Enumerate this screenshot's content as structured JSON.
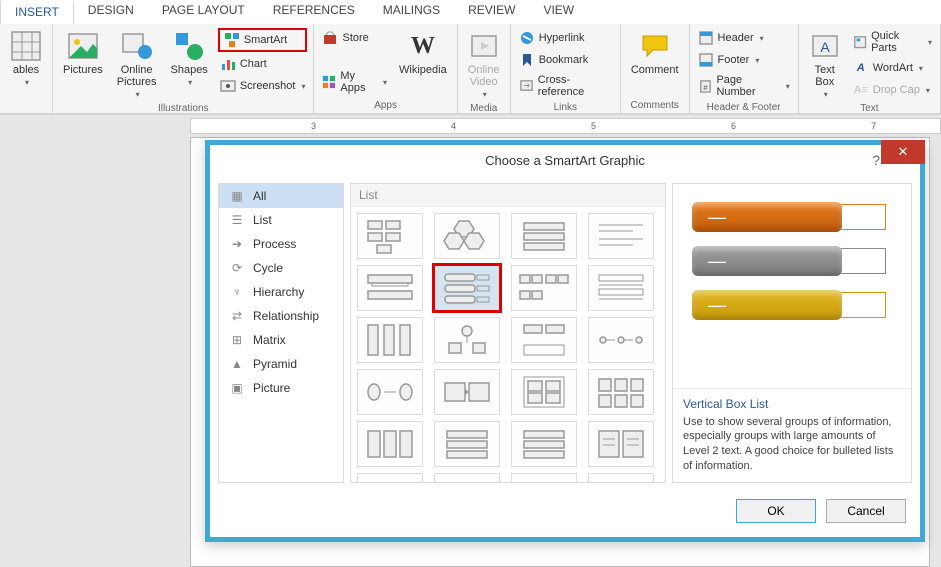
{
  "ribbon": {
    "tabs": [
      "INSERT",
      "DESIGN",
      "PAGE LAYOUT",
      "REFERENCES",
      "MAILINGS",
      "REVIEW",
      "VIEW"
    ],
    "active_tab": "INSERT",
    "groups": {
      "tables": {
        "label": "",
        "table_btn": "ables"
      },
      "illustrations": {
        "label": "Illustrations",
        "pictures": "Pictures",
        "online_pictures": "Online\nPictures",
        "shapes": "Shapes",
        "smartart": "SmartArt",
        "chart": "Chart",
        "screenshot": "Screenshot"
      },
      "apps": {
        "label": "Apps",
        "store": "Store",
        "my_apps": "My Apps"
      },
      "media": {
        "label": "Media",
        "wikipedia": "Wikipedia",
        "online_video": "Online\nVideo"
      },
      "links": {
        "label": "Links",
        "hyperlink": "Hyperlink",
        "bookmark": "Bookmark",
        "crossref": "Cross-reference"
      },
      "comments": {
        "label": "Comments",
        "comment": "Comment"
      },
      "headerfooter": {
        "label": "Header & Footer",
        "header": "Header",
        "footer": "Footer",
        "pagenum": "Page Number"
      },
      "text": {
        "label": "Text",
        "textbox": "Text\nBox",
        "quickparts": "Quick Parts",
        "wordart": "WordArt",
        "dropcap": "Drop Cap"
      }
    }
  },
  "ruler_marks": [
    "3",
    "4",
    "5",
    "6",
    "7"
  ],
  "dialog": {
    "title": "Choose a SmartArt Graphic",
    "help": "?",
    "close": "✕",
    "categories": [
      "All",
      "List",
      "Process",
      "Cycle",
      "Hierarchy",
      "Relationship",
      "Matrix",
      "Pyramid",
      "Picture"
    ],
    "selected_category": "All",
    "gallery_title": "List",
    "preview_name": "Vertical Box List",
    "preview_desc": "Use to show several groups of information, especially groups with large amounts of Level 2 text. A good choice for bulleted lists of information.",
    "pill_dash": "—",
    "ok": "OK",
    "cancel": "Cancel"
  }
}
